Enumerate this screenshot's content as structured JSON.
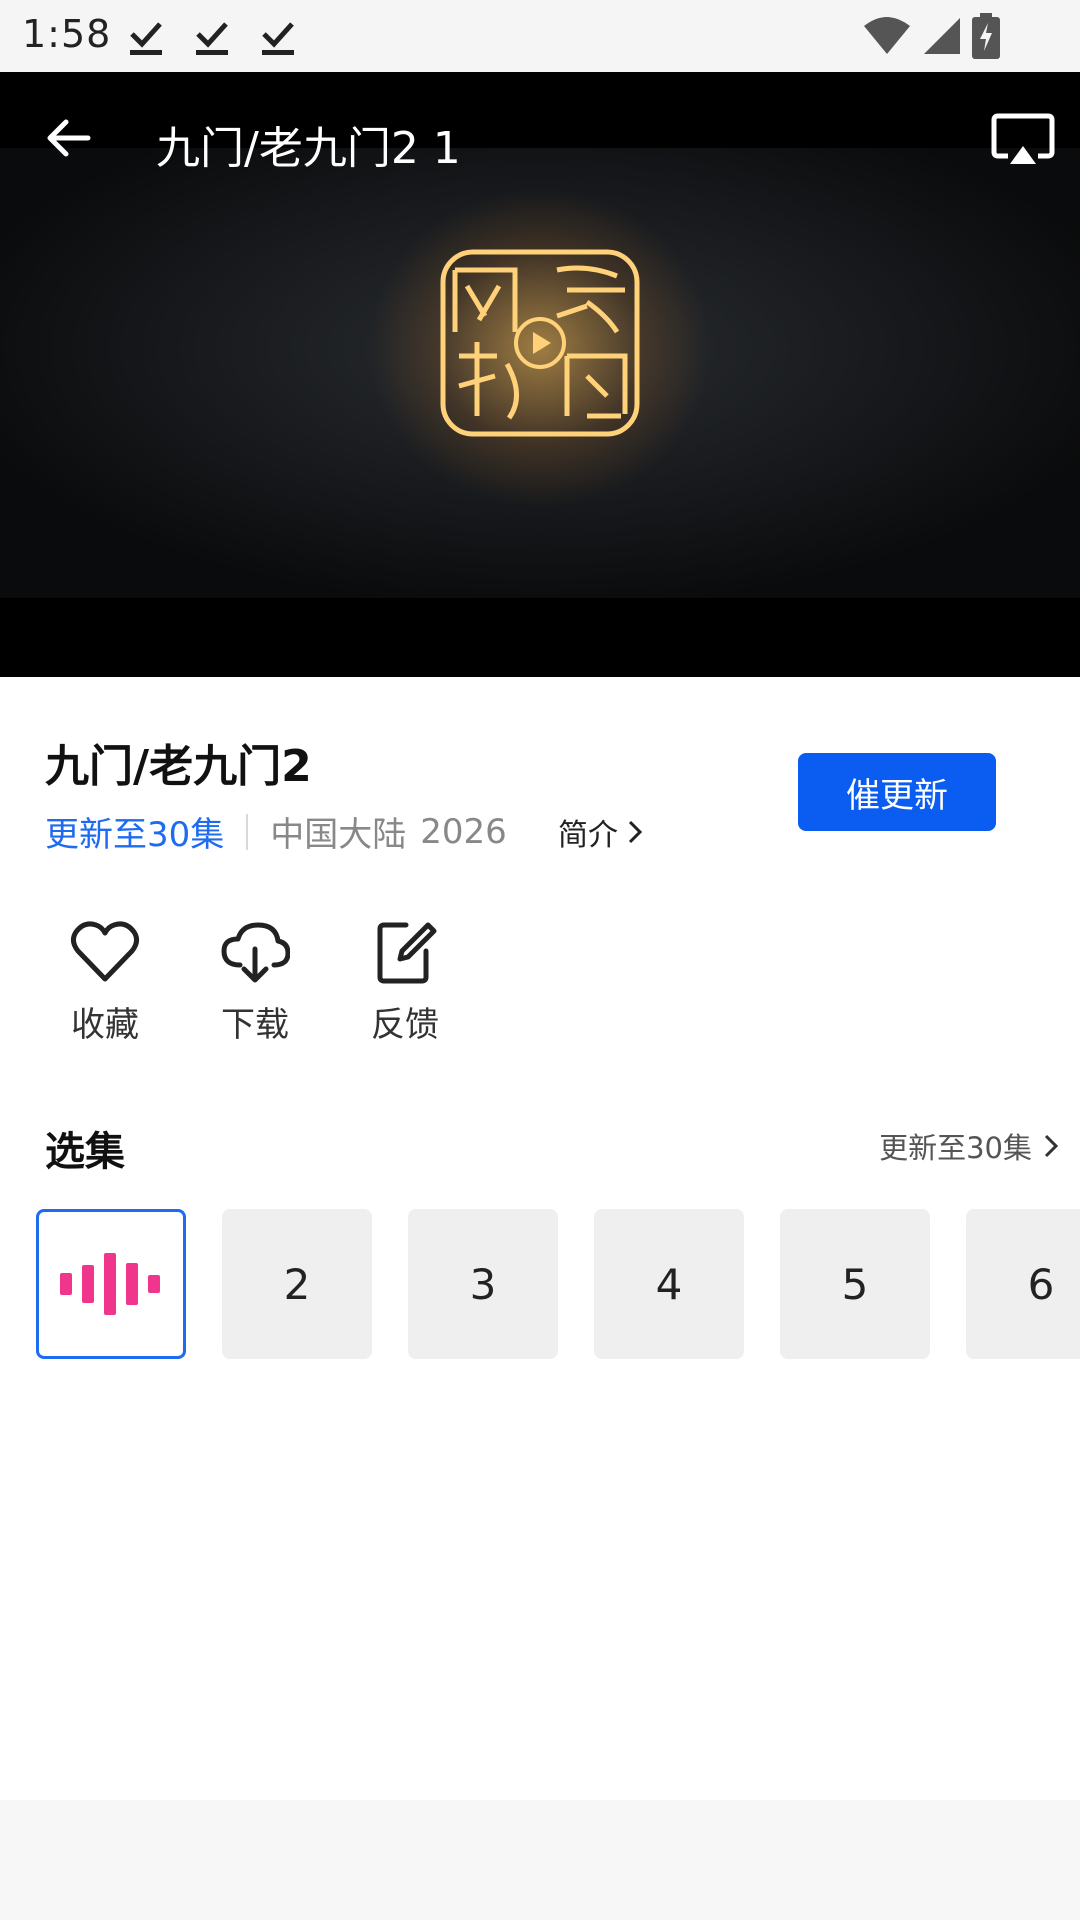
{
  "status_bar": {
    "time": "1:58",
    "icons": [
      "download-done-icon",
      "download-done-icon",
      "download-done-icon",
      "wifi-icon",
      "signal-icon",
      "battery-charging-icon"
    ]
  },
  "player": {
    "title": "九门/老九门2 1",
    "back_icon": "arrow-left-icon",
    "cast_icon": "airplay-icon",
    "logo_icon": "seal-logo-icon"
  },
  "show": {
    "title": "九门/老九门2",
    "update_text": "更新至30集",
    "region": "中国大陆",
    "year": "2026",
    "intro_label": "简介",
    "urge_button": "催更新"
  },
  "actions": [
    {
      "label": "收藏",
      "icon": "heart-icon"
    },
    {
      "label": "下载",
      "icon": "cloud-download-icon"
    },
    {
      "label": "反馈",
      "icon": "edit-note-icon"
    }
  ],
  "episodes": {
    "title": "选集",
    "more_label": "更新至30集",
    "items": [
      "",
      "2",
      "3",
      "4",
      "5",
      "6"
    ]
  },
  "colors": {
    "accent_blue": "#0b5cf0",
    "link_blue": "#1f6bf0",
    "playing_pink": "#f0368c"
  }
}
